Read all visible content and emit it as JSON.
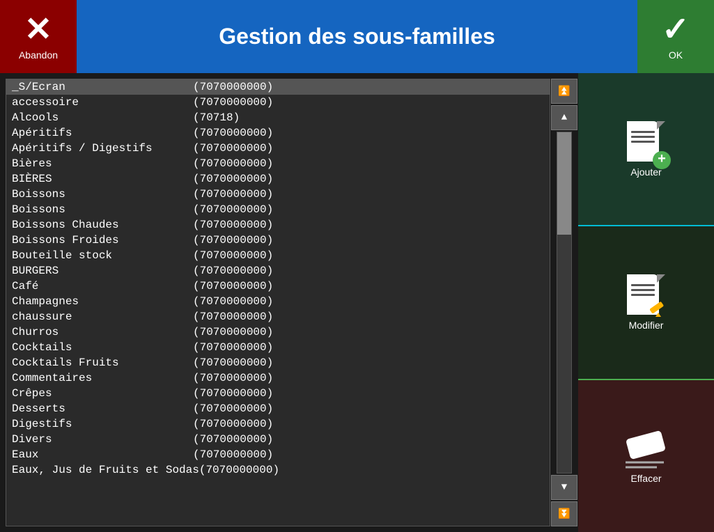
{
  "header": {
    "title": "Gestion des sous-familles",
    "abandon_label": "Abandon",
    "ok_label": "OK"
  },
  "list": {
    "items": [
      {
        "name": "_S/Ecran",
        "code": "(7070000000)",
        "selected": true
      },
      {
        "name": "accessoire",
        "code": "(7070000000)"
      },
      {
        "name": "Alcools",
        "code": "(70718)"
      },
      {
        "name": "Apéritifs",
        "code": "(7070000000)"
      },
      {
        "name": "Apéritifs / Digestifs",
        "code": "(7070000000)"
      },
      {
        "name": "Bières",
        "code": "(7070000000)"
      },
      {
        "name": "BIÈRES",
        "code": "(7070000000)"
      },
      {
        "name": "Boissons",
        "code": "(7070000000)"
      },
      {
        "name": "Boissons",
        "code": "(7070000000)"
      },
      {
        "name": "Boissons Chaudes",
        "code": "(7070000000)"
      },
      {
        "name": "Boissons Froides",
        "code": "(7070000000)"
      },
      {
        "name": "Bouteille stock",
        "code": "(7070000000)"
      },
      {
        "name": "BURGERS",
        "code": "(7070000000)"
      },
      {
        "name": "Café",
        "code": "(7070000000)"
      },
      {
        "name": "Champagnes",
        "code": "(7070000000)"
      },
      {
        "name": "chaussure",
        "code": "(7070000000)"
      },
      {
        "name": "Churros",
        "code": "(7070000000)"
      },
      {
        "name": "Cocktails",
        "code": "(7070000000)"
      },
      {
        "name": "Cocktails Fruits",
        "code": "(7070000000)"
      },
      {
        "name": "Commentaires",
        "code": "(7070000000)"
      },
      {
        "name": "Crêpes",
        "code": "(7070000000)"
      },
      {
        "name": "Desserts",
        "code": "(7070000000)"
      },
      {
        "name": "Digestifs",
        "code": "(7070000000)"
      },
      {
        "name": "Divers",
        "code": "(7070000000)"
      },
      {
        "name": "Eaux",
        "code": "(7070000000)"
      },
      {
        "name": "Eaux, Jus de Fruits et Sodas",
        "code": "(7070000000)"
      }
    ]
  },
  "sidebar": {
    "add_label": "Ajouter",
    "modify_label": "Modifier",
    "delete_label": "Effacer"
  },
  "scroll": {
    "top_top": "⏫",
    "top": "▲",
    "bottom": "▼",
    "bottom_bottom": "⏬"
  }
}
